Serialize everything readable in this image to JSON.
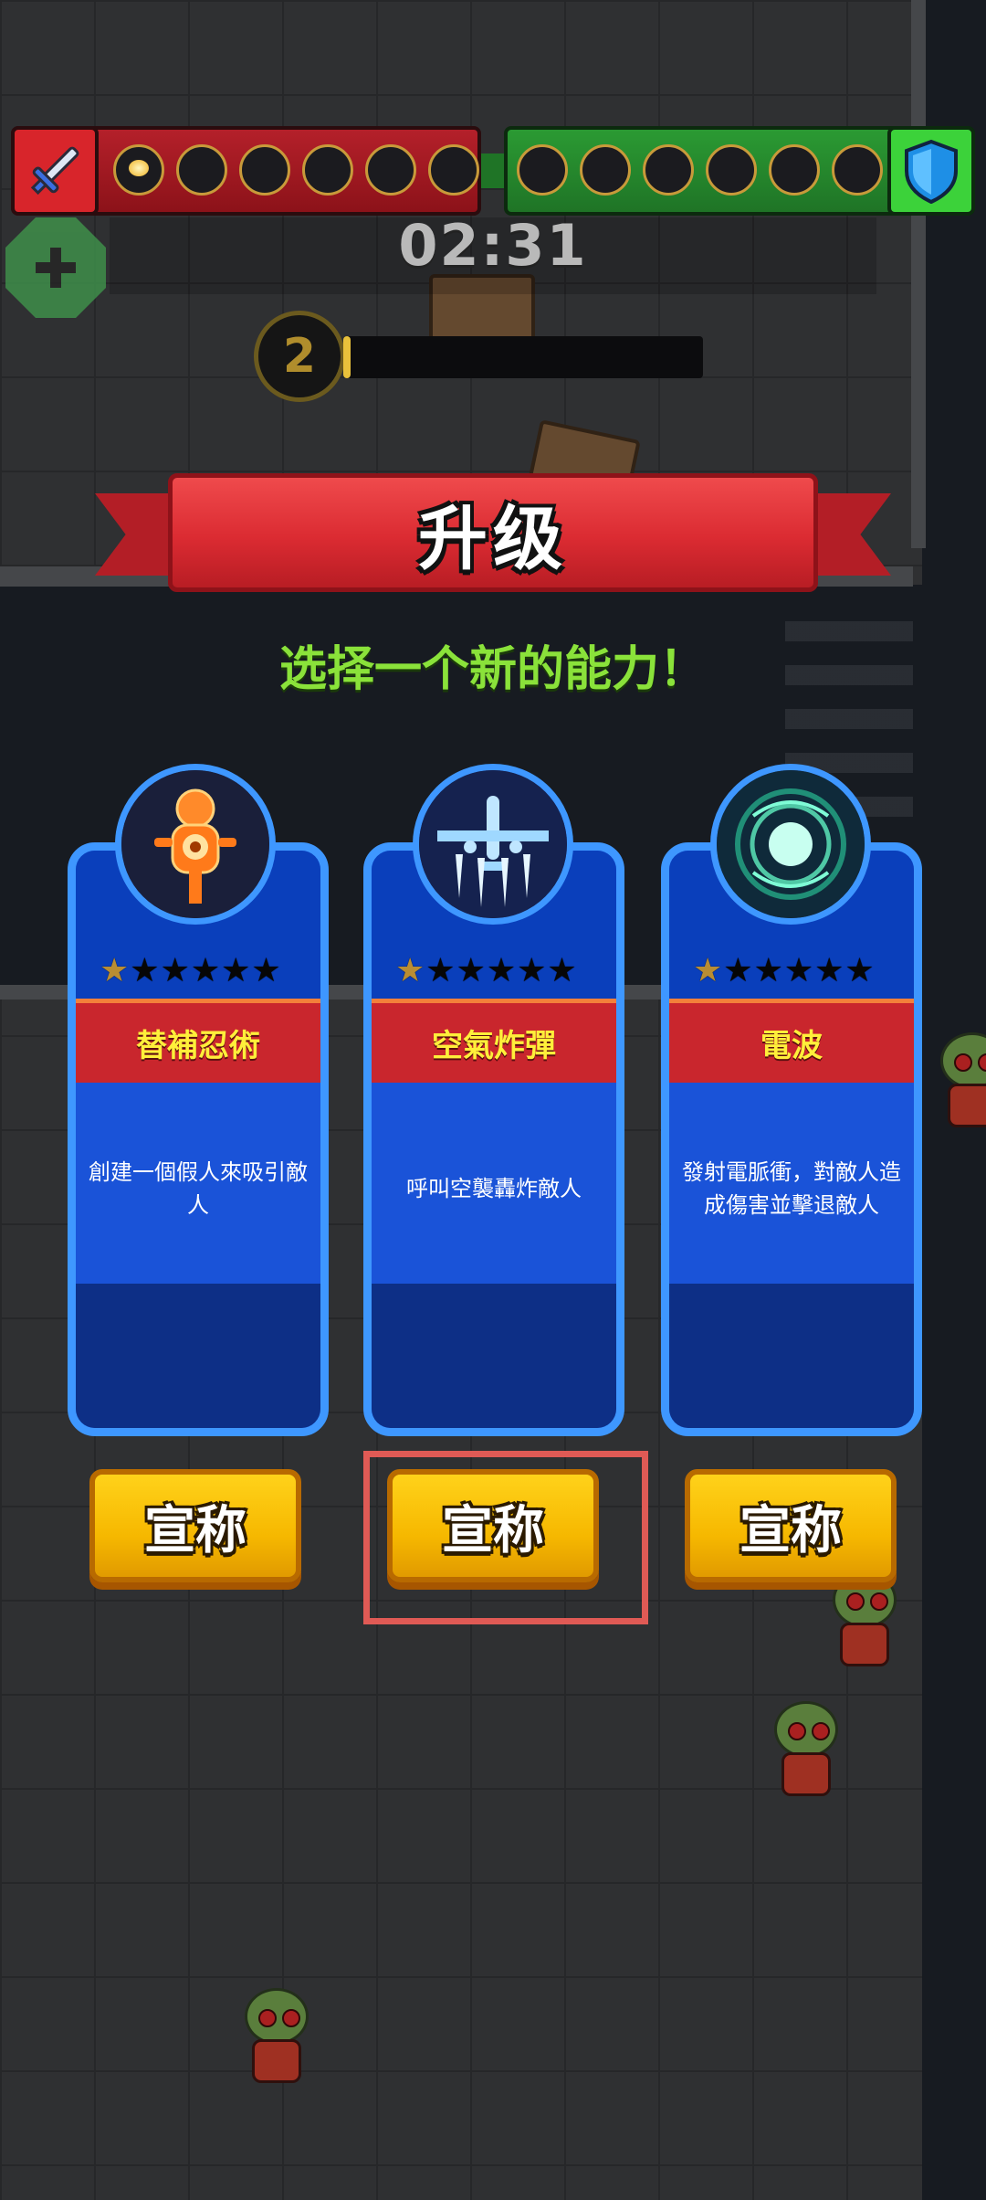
{
  "hud": {
    "timer": "02:31",
    "level": "2",
    "xp_progress": 0.02,
    "attack_slots_filled": 1,
    "attack_slots_total": 6,
    "defense_slots_total": 6
  },
  "upgrade": {
    "title": "升级",
    "subtitle": "选择一个新的能力！"
  },
  "cards": [
    {
      "name": "替補忍術",
      "description": "創建一個假人來吸引敵人",
      "stars_filled": 1,
      "stars_total": 6,
      "icon": "decoy-dummy-icon",
      "claim_label": "宣称"
    },
    {
      "name": "空氣炸彈",
      "description": "呼叫空襲轟炸敵人",
      "stars_filled": 1,
      "stars_total": 6,
      "icon": "airstrike-plane-icon",
      "claim_label": "宣称"
    },
    {
      "name": "電波",
      "description": "發射電脈衝，對敵人造成傷害並擊退敵人",
      "stars_filled": 1,
      "stars_total": 6,
      "icon": "electric-wave-icon",
      "claim_label": "宣称"
    }
  ],
  "colors": {
    "attack_bar": "#b4202a",
    "defense_bar": "#2b9a33",
    "card_border": "#3e97ff",
    "card_fill": "#1a53d8",
    "name_banner": "#c9262d",
    "claim_button": "#f6b800",
    "highlight": "#e05a55",
    "subtitle": "#8ae23a"
  }
}
